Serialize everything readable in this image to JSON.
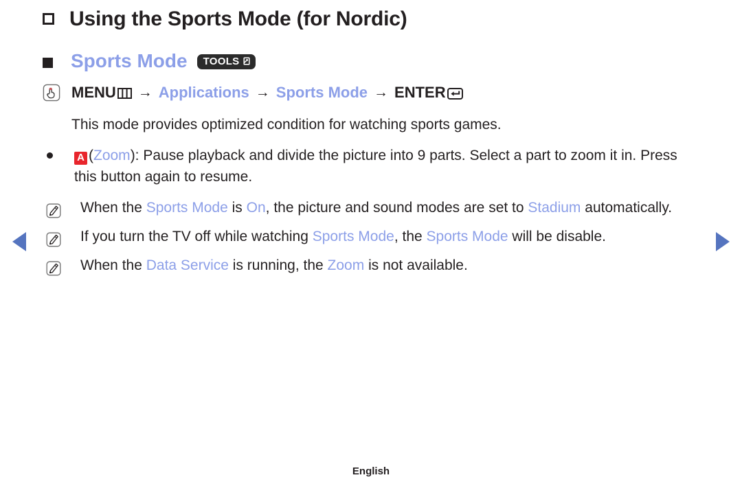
{
  "page": {
    "footer_label": "English"
  },
  "nav": {
    "prev_label": "prev-page-arrow",
    "next_label": "next-page-arrow"
  },
  "heading": {
    "title": "Using the Sports Mode (for Nordic)",
    "subtitle": "Sports Mode",
    "tools_badge": "TOOLS"
  },
  "menu_path": {
    "menu_label": "MENU",
    "arrow": "→",
    "step1": "Applications",
    "step2": "Sports Mode",
    "enter_label": "ENTER"
  },
  "intro": {
    "text": "This mode provides optimized condition for watching sports games."
  },
  "bullet": {
    "key": "A",
    "open_paren": "(",
    "key_name": "Zoom",
    "close_paren": "):",
    "text": " Pause playback and divide the picture into 9 parts. Select a part to zoom it in. Press this button again to resume."
  },
  "notes": [
    {
      "parts": [
        {
          "text": "When the ",
          "style": "plain"
        },
        {
          "text": "Sports Mode",
          "style": "accent"
        },
        {
          "text": " is ",
          "style": "plain"
        },
        {
          "text": "On",
          "style": "accent"
        },
        {
          "text": ", the picture and sound modes are set to ",
          "style": "plain"
        },
        {
          "text": "Stadium",
          "style": "accent"
        },
        {
          "text": " automatically.",
          "style": "plain"
        }
      ]
    },
    {
      "parts": [
        {
          "text": "If you turn the TV off while watching ",
          "style": "plain"
        },
        {
          "text": "Sports Mode",
          "style": "accent"
        },
        {
          "text": ", the ",
          "style": "plain"
        },
        {
          "text": "Sports Mode",
          "style": "accent"
        },
        {
          "text": " will be disable.",
          "style": "plain"
        }
      ]
    },
    {
      "parts": [
        {
          "text": "When the ",
          "style": "plain"
        },
        {
          "text": "Data Service",
          "style": "accent"
        },
        {
          "text": " is running, the ",
          "style": "plain"
        },
        {
          "text": "Zoom",
          "style": "accent"
        },
        {
          "text": " is not available.",
          "style": "plain"
        }
      ]
    }
  ],
  "colors": {
    "accent_blue": "#8c9fe8",
    "nav_blue": "#5574bf",
    "key_red": "#e8252c",
    "text_dark": "#231f20",
    "badge_dark": "#2b2b2b"
  },
  "icons": {
    "touch": "touch-hand-icon",
    "menu": "menu-grid-icon",
    "enter": "enter-return-icon",
    "note": "note-pencil-icon",
    "tools": "tools-window-icon"
  }
}
